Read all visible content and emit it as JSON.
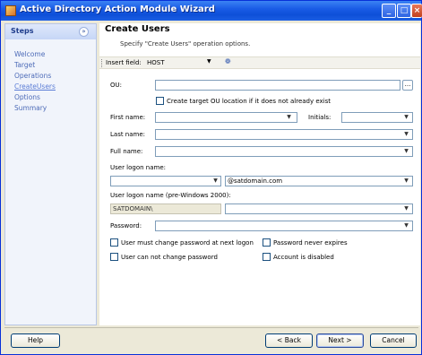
{
  "window": {
    "title": "Active Directory Action Module Wizard",
    "icons": {
      "app": "wizard-app-icon",
      "minimize": "minimize-icon",
      "maximize": "maximize-icon",
      "close": "close-icon"
    }
  },
  "sidebar": {
    "title": "Steps",
    "collapse_glyph": "»",
    "items": [
      {
        "label": "Welcome",
        "active": false
      },
      {
        "label": "Target",
        "active": false
      },
      {
        "label": "Operations",
        "active": false
      },
      {
        "label": "CreateUsers",
        "active": true
      },
      {
        "label": "Options",
        "active": false
      },
      {
        "label": "Summary",
        "active": false
      }
    ]
  },
  "main": {
    "title": "Create Users",
    "subtitle": "Specify \"Create Users\" operation options."
  },
  "toolbar": {
    "insert_field_label": "Insert field:",
    "insert_field_value": "HOST",
    "insert_glyph": "❁"
  },
  "form": {
    "ou_label": "OU:",
    "ou_value": "",
    "ou_browse": "...",
    "create_ou_label": "Create target OU location if it does not already exist",
    "first_name_label": "First name:",
    "first_name_value": "",
    "initials_label": "Initials:",
    "initials_value": "",
    "last_name_label": "Last name:",
    "last_name_value": "",
    "full_name_label": "Full name:",
    "full_name_value": "",
    "logon_name_label": "User logon name:",
    "logon_name_value": "",
    "domain_value": "@satdomain.com",
    "pre2000_label": "User logon name (pre-Windows 2000):",
    "pre2000_domain": "SATDOMAIN\\",
    "pre2000_value": "",
    "password_label": "Password:",
    "password_value": "",
    "must_change_label": "User must change password at next logon",
    "never_expires_label": "Password never expires",
    "cannot_change_label": "User can not change password",
    "disabled_label": "Account is disabled"
  },
  "dropdown_glyph": "▼",
  "buttons": {
    "help": "Help",
    "back": "< Back",
    "next": "Next >",
    "cancel": "Cancel"
  }
}
